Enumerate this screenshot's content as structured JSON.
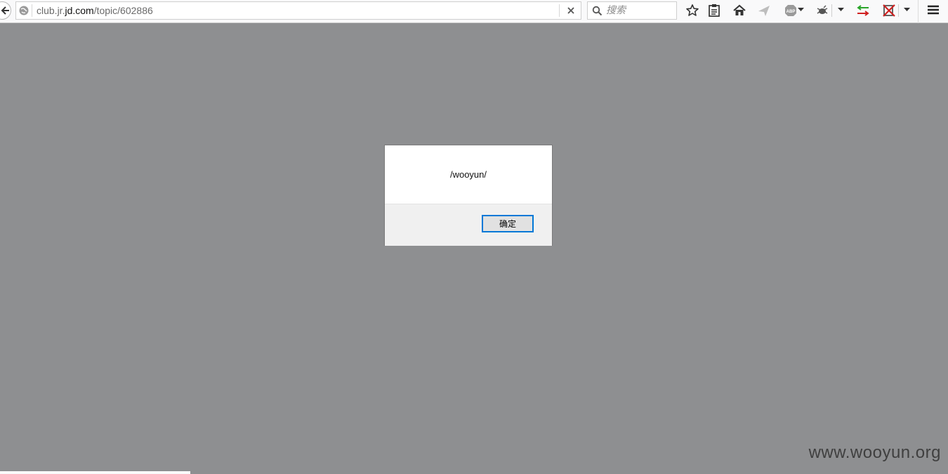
{
  "browser": {
    "url_prefix": "club.jr.",
    "url_domain": "jd.com",
    "url_path": "/topic/602886",
    "search_placeholder": "搜索",
    "clear_glyph": "✕"
  },
  "icons": [
    "back-arrow-icon",
    "globe-icon",
    "clear-url-icon",
    "search-icon",
    "bookmark-star-icon",
    "reading-list-icon",
    "home-icon",
    "pocket-send-icon",
    "adblock-plus-icon",
    "extension-icon",
    "dropdown-icon",
    "sync-arrows-icon",
    "blocked-script-icon",
    "menu-icon"
  ],
  "dialog": {
    "message": "/wooyun/",
    "ok_label": "确定"
  },
  "watermark": "www.wooyun.org",
  "colors": {
    "page_overlay": "#8e8f91",
    "button_focus": "#0078d7",
    "sync_green": "#2aa52a",
    "sync_red": "#d02020"
  }
}
